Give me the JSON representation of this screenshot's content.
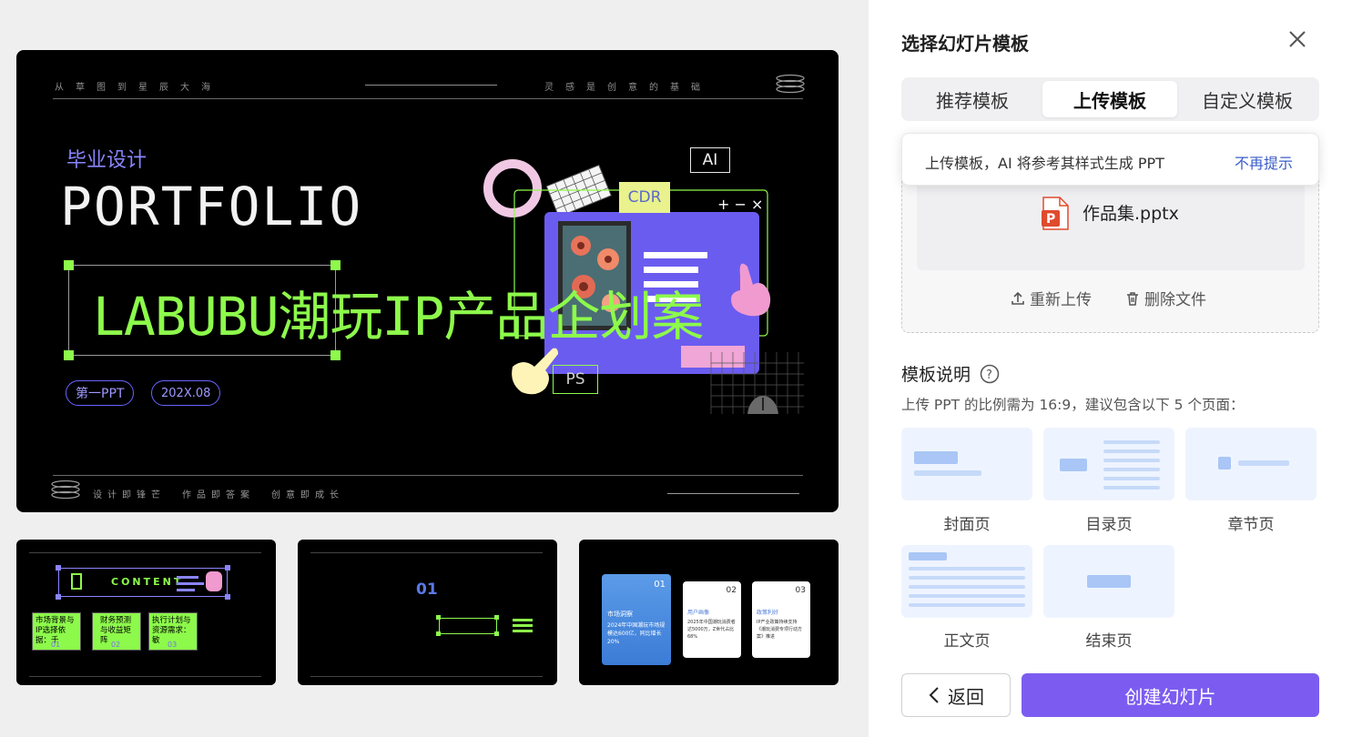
{
  "panel": {
    "title": "选择幻灯片模板",
    "close_icon": "close-icon",
    "tabs": [
      {
        "label": "推荐模板",
        "active": false
      },
      {
        "label": "上传模板",
        "active": true
      },
      {
        "label": "自定义模板",
        "active": false
      }
    ],
    "tooltip": {
      "text": "上传模板，AI 将参考其样式生成 PPT",
      "dismiss": "不再提示"
    },
    "file": {
      "name": "作品集.pptx",
      "icon": "pptx-file-icon"
    },
    "actions": {
      "reupload": "重新上传",
      "delete": "删除文件"
    },
    "section": {
      "title": "模板说明",
      "help_icon": "question-circle-icon",
      "desc": "上传 PPT 的比例需为 16:9，建议包含以下 5 个页面："
    },
    "pages": [
      "封面页",
      "目录页",
      "章节页",
      "正文页",
      "结束页"
    ],
    "buttons": {
      "back": "返回",
      "create": "创建幻灯片"
    },
    "accent_color": "#7c5cf0"
  },
  "main_slide": {
    "top_left": "从草图到星辰大海",
    "top_right": "灵感是创意的基础",
    "subtitle": "毕业设计",
    "title": "PORTFOLIO",
    "green_title": "LABUBU潮玩IP产品企划案",
    "pill1": "第一PPT",
    "pill2": "202X.08",
    "bottom_items": [
      "设计即锋芒",
      "作品即答案",
      "创意即成长"
    ],
    "badges": {
      "ai": "AI",
      "cdr": "CDR",
      "ps": "PS"
    }
  },
  "thumb1": {
    "title": "CONTENT",
    "cards": [
      "市场背景与IP选择依据：千",
      "财务预测与收益矩阵",
      "执行计划与资源需求：敏"
    ],
    "nums": [
      "01",
      "02",
      "03"
    ]
  },
  "thumb2": {
    "num": "01"
  },
  "thumb3": {
    "cards": [
      {
        "num": "01",
        "title": "市场洞察",
        "text": "2024年中国潮玩市场规模达600亿，同比增长20%"
      },
      {
        "num": "02",
        "title": "用户画像",
        "text": "2025年中国潮玩消费者达5000万，Z世代占比68%"
      },
      {
        "num": "03",
        "title": "政策利好",
        "text": "IP产业政策持续支持《潮玩消费专项行动方案》推进"
      }
    ]
  }
}
